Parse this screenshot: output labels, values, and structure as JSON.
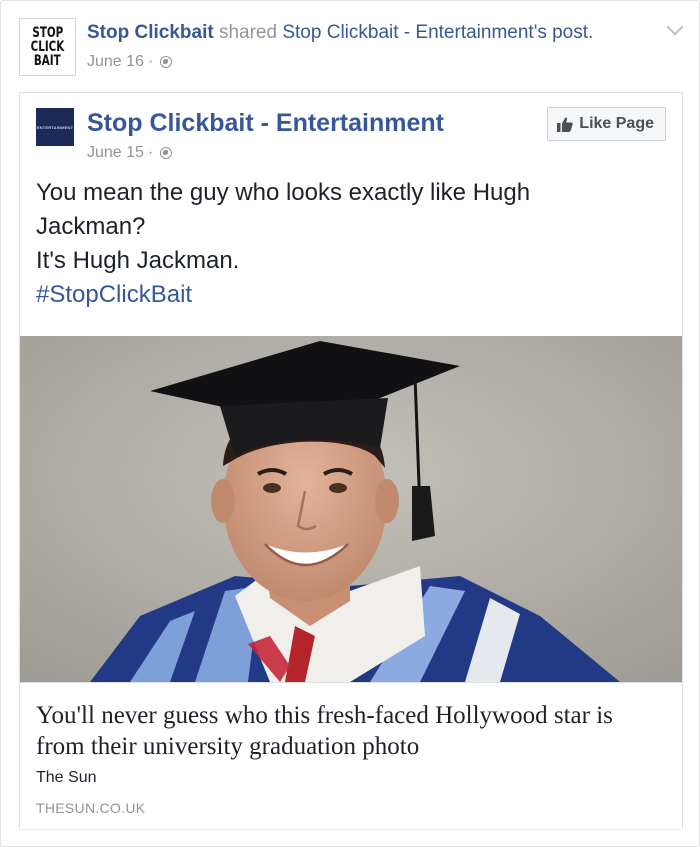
{
  "share": {
    "actor": "Stop Clickbait",
    "verb": "shared",
    "source": "Stop Clickbait - Entertainment",
    "suffix": "'s post.",
    "date": "June 16",
    "separator": "·",
    "logo_lines": [
      "STOP",
      "CLICK",
      "BAIT"
    ]
  },
  "post": {
    "page_name": "Stop Clickbait - Entertainment",
    "avatar_text": "ENTERTAINMENT",
    "date": "June 15",
    "separator": "·",
    "like_button": "Like Page",
    "text_lines": [
      "You mean the guy who looks exactly like Hugh",
      "Jackman?",
      "It's Hugh Jackman."
    ],
    "hashtag": "#StopClickBait"
  },
  "link": {
    "title": "You'll never guess who this fresh-faced Hollywood star is from their university graduation photo",
    "description": "The Sun",
    "domain": "THESUN.CO.UK"
  },
  "icons": {
    "privacy": "globe-icon",
    "options": "chevron-down-icon",
    "like": "thumbs-up-icon"
  },
  "colors": {
    "link_blue": "#365899",
    "meta_gray": "#90949c",
    "text": "#1d2129"
  }
}
